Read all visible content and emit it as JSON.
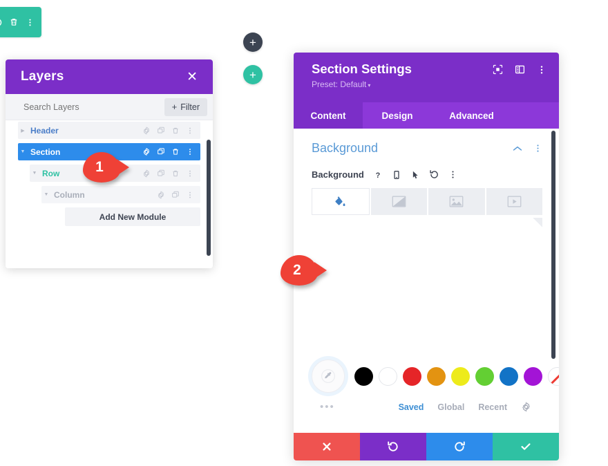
{
  "toolbar": {
    "items": [
      {
        "name": "collapse-icon",
        "label": ""
      },
      {
        "name": "trash-icon",
        "label": ""
      },
      {
        "name": "more-vertical-icon",
        "label": ""
      }
    ],
    "color": "#2fc1a3"
  },
  "add_buttons": {
    "dark_label": "+",
    "dark_color": "#3c4452",
    "green_label": "+",
    "green_color": "#2fc1a3"
  },
  "layers": {
    "title": "Layers",
    "close_label": "✕",
    "search": {
      "placeholder": "Search Layers",
      "value": ""
    },
    "filter_label": "Filter",
    "filter_plus": "+",
    "rows": [
      {
        "label": "Header",
        "caret": "▶",
        "selected": false
      },
      {
        "label": "Section",
        "caret": "▼",
        "selected": true
      },
      {
        "label": "Row",
        "caret": "▼",
        "selected": false
      },
      {
        "label": "Column",
        "caret": "▼",
        "selected": false
      }
    ],
    "add_module_label": "Add New Module",
    "row_icons": [
      "gear-icon",
      "duplicate-icon",
      "trash-icon",
      "more-vertical-icon"
    ]
  },
  "callouts": [
    {
      "number": "1",
      "color": "#ef4136"
    },
    {
      "number": "2",
      "color": "#ef4136"
    }
  ],
  "settings": {
    "title": "Section Settings",
    "preset": "Preset: Default",
    "preset_caret": "▾",
    "header_icons": [
      "fullscreen-icon",
      "layout-columns-icon",
      "more-vertical-icon"
    ],
    "tabs": [
      {
        "label": "Content",
        "active": true
      },
      {
        "label": "Design",
        "active": false
      },
      {
        "label": "Advanced",
        "active": false
      }
    ],
    "background_section": {
      "title": "Background",
      "collapse_icon": "chevron-up-icon",
      "more_icon": "more-vertical-icon",
      "field_label": "Background",
      "field_icons": [
        "help-icon",
        "responsive-icon",
        "hover-icon",
        "reset-icon",
        "more-vertical-icon"
      ],
      "types": [
        {
          "name": "background-color-tab",
          "icon": "paint-bucket-icon",
          "active": true
        },
        {
          "name": "background-gradient-tab",
          "icon": "gradient-icon",
          "active": false
        },
        {
          "name": "background-image-tab",
          "icon": "image-icon",
          "active": false
        },
        {
          "name": "background-video-tab",
          "icon": "video-icon",
          "active": false
        }
      ]
    },
    "color_picker": {
      "eyedropper_icon": "eyedropper-icon",
      "dots_label": "•••",
      "swatches": [
        {
          "name": "swatch-black",
          "color": "#000000"
        },
        {
          "name": "swatch-white",
          "color": "#ffffff"
        },
        {
          "name": "swatch-red",
          "color": "#e52528"
        },
        {
          "name": "swatch-orange",
          "color": "#e39311"
        },
        {
          "name": "swatch-yellow",
          "color": "#edeb1b"
        },
        {
          "name": "swatch-green",
          "color": "#63cf33"
        },
        {
          "name": "swatch-blue",
          "color": "#1273c6"
        },
        {
          "name": "swatch-purple",
          "color": "#a314d6"
        },
        {
          "name": "swatch-none",
          "color": "#ffffff"
        }
      ],
      "tabs": [
        {
          "label": "Saved",
          "active": true
        },
        {
          "label": "Global",
          "active": false
        },
        {
          "label": "Recent",
          "active": false
        }
      ],
      "gear_icon": "gear-icon"
    },
    "actions": [
      {
        "name": "cancel-button",
        "icon": "close-icon",
        "color": "#ef5350"
      },
      {
        "name": "undo-button",
        "icon": "undo-icon",
        "color": "#7b2ec8"
      },
      {
        "name": "redo-button",
        "icon": "redo-icon",
        "color": "#2d8ceb"
      },
      {
        "name": "save-button",
        "icon": "check-icon",
        "color": "#2fc1a3"
      }
    ]
  }
}
